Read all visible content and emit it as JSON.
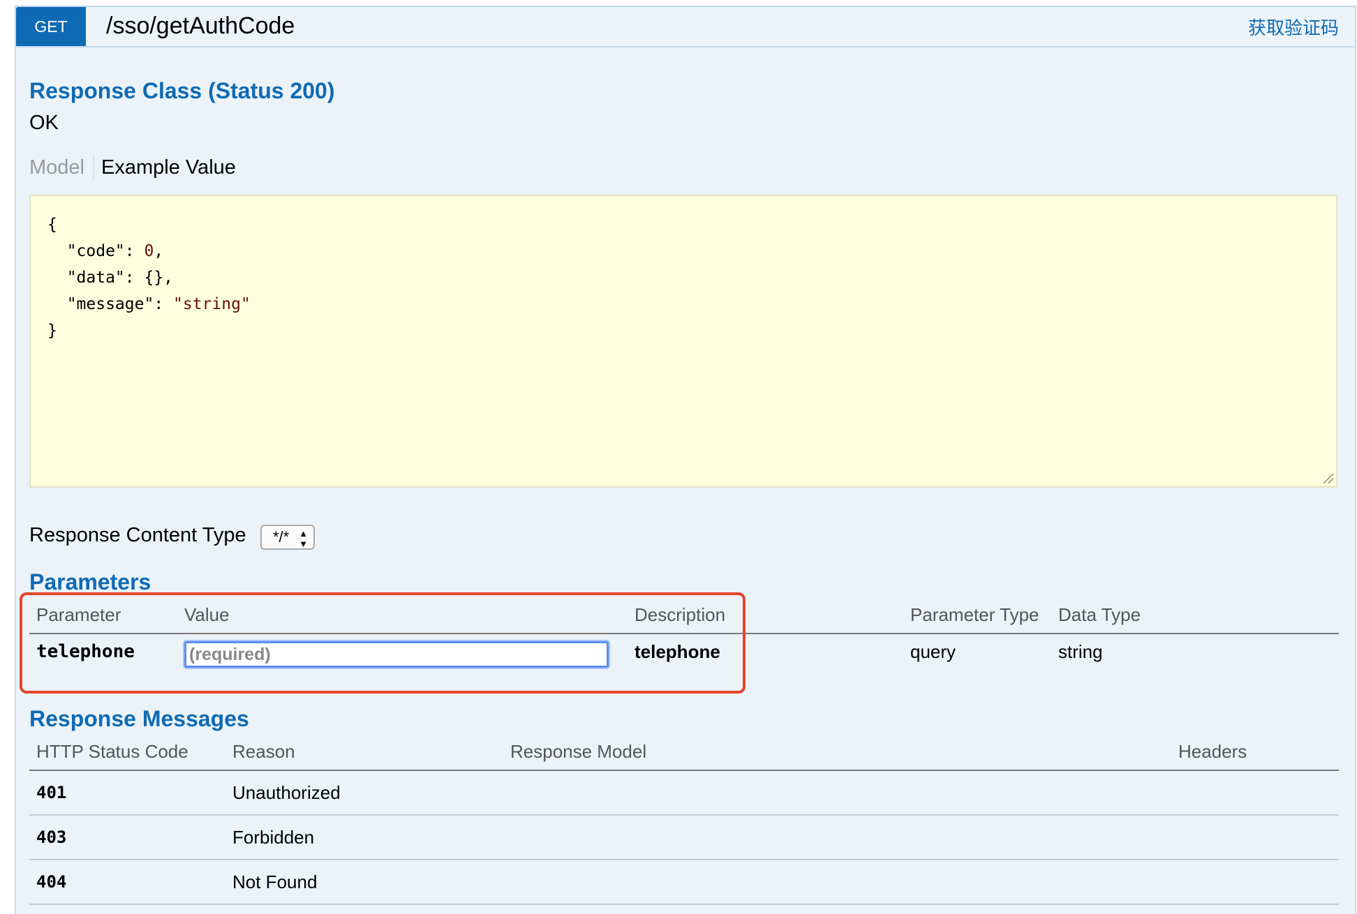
{
  "operation": {
    "method": "GET",
    "path": "/sso/getAuthCode",
    "summary": "获取验证码"
  },
  "response_class": {
    "title": "Response Class (Status 200)",
    "status_text": "OK",
    "tabs": [
      "Model",
      "Example Value"
    ],
    "example": {
      "open": "{",
      "line1_key": "  \"code\": ",
      "line1_val": "0",
      "line1_end": ",",
      "line2": "  \"data\": {},",
      "line3_key": "  \"message\": ",
      "line3_val": "\"string\"",
      "close": "}"
    }
  },
  "content_type": {
    "label": "Response Content Type",
    "selected": "*/*"
  },
  "parameters": {
    "title": "Parameters",
    "headers": [
      "Parameter",
      "Value",
      "Description",
      "Parameter Type",
      "Data Type"
    ],
    "rows": [
      {
        "name": "telephone",
        "placeholder": "(required)",
        "description": "telephone",
        "param_type": "query",
        "data_type": "string"
      }
    ]
  },
  "response_messages": {
    "title": "Response Messages",
    "headers": [
      "HTTP Status Code",
      "Reason",
      "Response Model",
      "Headers"
    ],
    "rows": [
      {
        "code": "401",
        "reason": "Unauthorized"
      },
      {
        "code": "403",
        "reason": "Forbidden"
      },
      {
        "code": "404",
        "reason": "Not Found"
      }
    ]
  }
}
